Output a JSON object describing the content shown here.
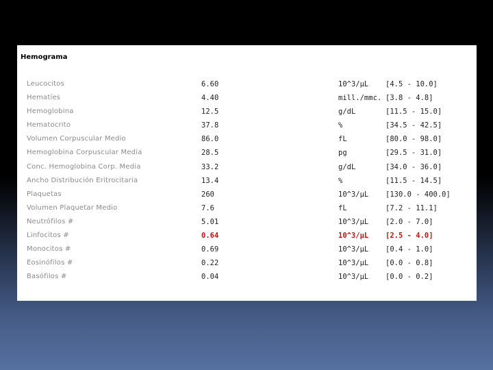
{
  "report": {
    "title": "Hemograma",
    "rows": [
      {
        "name": "Leucocitos",
        "value": "6.60",
        "unit": "10^3/µL",
        "range": "[4.5 - 10.0]",
        "flag": false
      },
      {
        "name": "Hematíes",
        "value": "4.40",
        "unit": "mill./mmc.",
        "range": "[3.8 - 4.8]",
        "flag": false
      },
      {
        "name": "Hemoglobina",
        "value": "12.5",
        "unit": "g/dL",
        "range": "[11.5 - 15.0]",
        "flag": false
      },
      {
        "name": "Hematocrito",
        "value": "37.8",
        "unit": "%",
        "range": "[34.5 - 42.5]",
        "flag": false
      },
      {
        "name": "Volumen Corpuscular Medio",
        "value": "86.0",
        "unit": "fL",
        "range": "[80.0 - 98.0]",
        "flag": false
      },
      {
        "name": "Hemoglobina Corpuscular Media",
        "value": "28.5",
        "unit": "pg",
        "range": "[29.5 - 31.0]",
        "flag": false
      },
      {
        "name": "Conc. Hemoglobina Corp. Media",
        "value": "33.2",
        "unit": "g/dL",
        "range": "[34.0 - 36.0]",
        "flag": false
      },
      {
        "name": "Ancho Distribución Eritrocitaria",
        "value": "13.4",
        "unit": "%",
        "range": "[11.5 - 14.5]",
        "flag": false
      },
      {
        "name": "Plaquetas",
        "value": "260",
        "unit": "10^3/µL",
        "range": "[130.0 - 400.0]",
        "flag": false
      },
      {
        "name": "Volumen Plaquetar Medio",
        "value": "7.6",
        "unit": "fL",
        "range": "[7.2 - 11.1]",
        "flag": false
      },
      {
        "name": "Neutrófilos #",
        "value": "5.01",
        "unit": "10^3/µL",
        "range": "[2.0 - 7.0]",
        "flag": false
      },
      {
        "name": "Linfocitos #",
        "value": "0.64",
        "unit": "10^3/µL",
        "range": "[2.5 - 4.0]",
        "flag": true
      },
      {
        "name": "Monocitos #",
        "value": "0.69",
        "unit": "10^3/µL",
        "range": "[0.4 - 1.0]",
        "flag": false
      },
      {
        "name": "Eosinófilos #",
        "value": "0.22",
        "unit": "10^3/µL",
        "range": "[0.0 - 0.8]",
        "flag": false
      },
      {
        "name": "Basófilos #",
        "value": "0.04",
        "unit": "10^3/µL",
        "range": "[0.0 - 0.2]",
        "flag": false
      }
    ]
  },
  "colors": {
    "flag": "#cc1111",
    "label": "#8a8a8a",
    "value": "#222222",
    "panel": "#ffffff"
  }
}
